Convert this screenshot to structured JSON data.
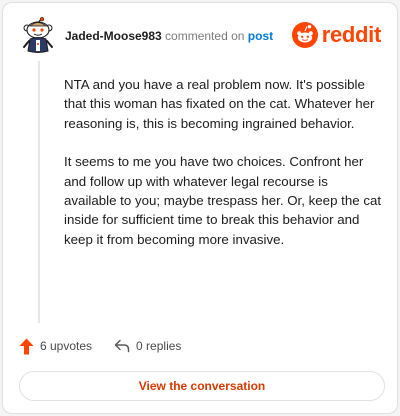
{
  "header": {
    "username": "Jaded-Moose983",
    "action_text": "commented on",
    "post_link": "post",
    "brand_name": "reddit"
  },
  "comment": {
    "paragraphs": [
      "NTA and you have a real problem now. It's possible that this woman has fixated on the cat. Whatever her reasoning is, this is becoming ingrained behavior.",
      "It seems to me you have two choices. Confront her and follow up with whatever legal recourse is available to you; maybe trespass her. Or, keep the cat inside for sufficient time to break this behavior and keep it from becoming more invasive."
    ]
  },
  "actions": {
    "upvotes": "6 upvotes",
    "replies": "0 replies"
  },
  "footer": {
    "conversation_button": "View the conversation"
  },
  "colors": {
    "brand": "#ff4500",
    "link": "#0079d3",
    "button_text": "#d93a00"
  },
  "icons": {
    "avatar": "snoo-avatar",
    "brand": "reddit-logo-icon",
    "upvote": "upvote-arrow-icon",
    "reply": "reply-arrow-icon"
  }
}
